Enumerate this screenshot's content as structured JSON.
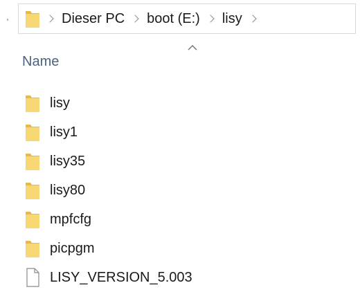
{
  "breadcrumb": [
    "Dieser PC",
    "boot (E:)",
    "lisy"
  ],
  "column_header": "Name",
  "items": [
    {
      "name": "lisy",
      "type": "folder"
    },
    {
      "name": "lisy1",
      "type": "folder"
    },
    {
      "name": "lisy35",
      "type": "folder"
    },
    {
      "name": "lisy80",
      "type": "folder"
    },
    {
      "name": "mpfcfg",
      "type": "folder"
    },
    {
      "name": "picpgm",
      "type": "folder"
    },
    {
      "name": "LISY_VERSION_5.003",
      "type": "file"
    }
  ],
  "icons": {
    "folder": "folder-icon",
    "file": "document-icon",
    "separator": "chevron-right-icon",
    "sort": "sort-ascending-icon"
  },
  "colors": {
    "folder": "#f8d775",
    "folder_dark": "#e8b94a",
    "header_text": "#4c6280",
    "border": "#d9d9d9"
  }
}
